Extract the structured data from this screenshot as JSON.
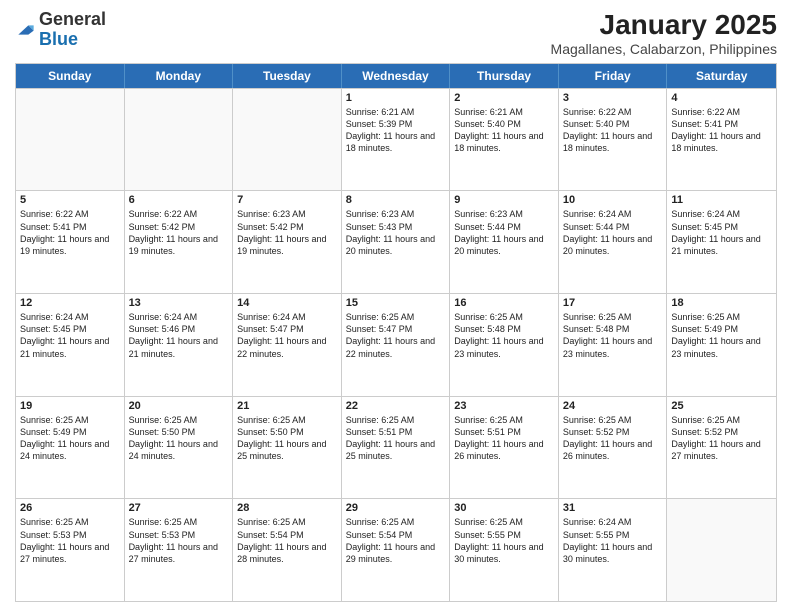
{
  "header": {
    "logo_general": "General",
    "logo_blue": "Blue",
    "title": "January 2025",
    "subtitle": "Magallanes, Calabarzon, Philippines"
  },
  "calendar": {
    "days_of_week": [
      "Sunday",
      "Monday",
      "Tuesday",
      "Wednesday",
      "Thursday",
      "Friday",
      "Saturday"
    ],
    "weeks": [
      [
        {
          "day": "",
          "info": ""
        },
        {
          "day": "",
          "info": ""
        },
        {
          "day": "",
          "info": ""
        },
        {
          "day": "1",
          "info": "Sunrise: 6:21 AM\nSunset: 5:39 PM\nDaylight: 11 hours and 18 minutes."
        },
        {
          "day": "2",
          "info": "Sunrise: 6:21 AM\nSunset: 5:40 PM\nDaylight: 11 hours and 18 minutes."
        },
        {
          "day": "3",
          "info": "Sunrise: 6:22 AM\nSunset: 5:40 PM\nDaylight: 11 hours and 18 minutes."
        },
        {
          "day": "4",
          "info": "Sunrise: 6:22 AM\nSunset: 5:41 PM\nDaylight: 11 hours and 18 minutes."
        }
      ],
      [
        {
          "day": "5",
          "info": "Sunrise: 6:22 AM\nSunset: 5:41 PM\nDaylight: 11 hours and 19 minutes."
        },
        {
          "day": "6",
          "info": "Sunrise: 6:22 AM\nSunset: 5:42 PM\nDaylight: 11 hours and 19 minutes."
        },
        {
          "day": "7",
          "info": "Sunrise: 6:23 AM\nSunset: 5:42 PM\nDaylight: 11 hours and 19 minutes."
        },
        {
          "day": "8",
          "info": "Sunrise: 6:23 AM\nSunset: 5:43 PM\nDaylight: 11 hours and 20 minutes."
        },
        {
          "day": "9",
          "info": "Sunrise: 6:23 AM\nSunset: 5:44 PM\nDaylight: 11 hours and 20 minutes."
        },
        {
          "day": "10",
          "info": "Sunrise: 6:24 AM\nSunset: 5:44 PM\nDaylight: 11 hours and 20 minutes."
        },
        {
          "day": "11",
          "info": "Sunrise: 6:24 AM\nSunset: 5:45 PM\nDaylight: 11 hours and 21 minutes."
        }
      ],
      [
        {
          "day": "12",
          "info": "Sunrise: 6:24 AM\nSunset: 5:45 PM\nDaylight: 11 hours and 21 minutes."
        },
        {
          "day": "13",
          "info": "Sunrise: 6:24 AM\nSunset: 5:46 PM\nDaylight: 11 hours and 21 minutes."
        },
        {
          "day": "14",
          "info": "Sunrise: 6:24 AM\nSunset: 5:47 PM\nDaylight: 11 hours and 22 minutes."
        },
        {
          "day": "15",
          "info": "Sunrise: 6:25 AM\nSunset: 5:47 PM\nDaylight: 11 hours and 22 minutes."
        },
        {
          "day": "16",
          "info": "Sunrise: 6:25 AM\nSunset: 5:48 PM\nDaylight: 11 hours and 23 minutes."
        },
        {
          "day": "17",
          "info": "Sunrise: 6:25 AM\nSunset: 5:48 PM\nDaylight: 11 hours and 23 minutes."
        },
        {
          "day": "18",
          "info": "Sunrise: 6:25 AM\nSunset: 5:49 PM\nDaylight: 11 hours and 23 minutes."
        }
      ],
      [
        {
          "day": "19",
          "info": "Sunrise: 6:25 AM\nSunset: 5:49 PM\nDaylight: 11 hours and 24 minutes."
        },
        {
          "day": "20",
          "info": "Sunrise: 6:25 AM\nSunset: 5:50 PM\nDaylight: 11 hours and 24 minutes."
        },
        {
          "day": "21",
          "info": "Sunrise: 6:25 AM\nSunset: 5:50 PM\nDaylight: 11 hours and 25 minutes."
        },
        {
          "day": "22",
          "info": "Sunrise: 6:25 AM\nSunset: 5:51 PM\nDaylight: 11 hours and 25 minutes."
        },
        {
          "day": "23",
          "info": "Sunrise: 6:25 AM\nSunset: 5:51 PM\nDaylight: 11 hours and 26 minutes."
        },
        {
          "day": "24",
          "info": "Sunrise: 6:25 AM\nSunset: 5:52 PM\nDaylight: 11 hours and 26 minutes."
        },
        {
          "day": "25",
          "info": "Sunrise: 6:25 AM\nSunset: 5:52 PM\nDaylight: 11 hours and 27 minutes."
        }
      ],
      [
        {
          "day": "26",
          "info": "Sunrise: 6:25 AM\nSunset: 5:53 PM\nDaylight: 11 hours and 27 minutes."
        },
        {
          "day": "27",
          "info": "Sunrise: 6:25 AM\nSunset: 5:53 PM\nDaylight: 11 hours and 27 minutes."
        },
        {
          "day": "28",
          "info": "Sunrise: 6:25 AM\nSunset: 5:54 PM\nDaylight: 11 hours and 28 minutes."
        },
        {
          "day": "29",
          "info": "Sunrise: 6:25 AM\nSunset: 5:54 PM\nDaylight: 11 hours and 29 minutes."
        },
        {
          "day": "30",
          "info": "Sunrise: 6:25 AM\nSunset: 5:55 PM\nDaylight: 11 hours and 30 minutes."
        },
        {
          "day": "31",
          "info": "Sunrise: 6:24 AM\nSunset: 5:55 PM\nDaylight: 11 hours and 30 minutes."
        },
        {
          "day": "",
          "info": ""
        }
      ]
    ]
  }
}
